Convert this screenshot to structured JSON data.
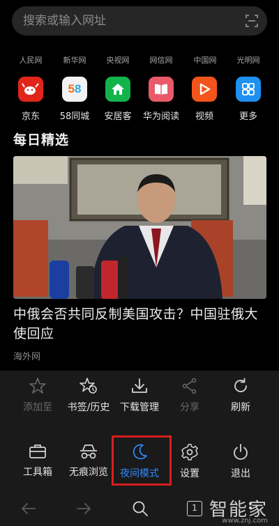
{
  "search": {
    "placeholder": "搜索或输入网址",
    "scan_icon": "scan-icon"
  },
  "sites": [
    "人民网",
    "新华网",
    "央视网",
    "网信网",
    "中国网",
    "光明网"
  ],
  "apps": [
    {
      "label": "京东",
      "icon": "jd-icon",
      "color": "#e1251b"
    },
    {
      "label": "58同城",
      "icon": "58-icon",
      "color": "#f2f2f2"
    },
    {
      "label": "安居客",
      "icon": "anjuke-icon",
      "color": "#13b34b"
    },
    {
      "label": "华为阅读",
      "icon": "huawei-reading-icon",
      "color": "#e85a6a"
    },
    {
      "label": "视频",
      "icon": "video-icon",
      "color": "#f2541b"
    },
    {
      "label": "更多",
      "icon": "more-icon",
      "color": "#1f8ff0"
    }
  ],
  "section_title": "每日精选",
  "news": {
    "title": "中俄会否共同反制美国攻击？中国驻俄大使回应",
    "source": "海外网"
  },
  "menu": {
    "row1": [
      {
        "label": "添加至",
        "state": "disabled"
      },
      {
        "label": "书签/历史",
        "state": "normal"
      },
      {
        "label": "下载管理",
        "state": "normal"
      },
      {
        "label": "分享",
        "state": "disabled"
      },
      {
        "label": "刷新",
        "state": "normal"
      }
    ],
    "row2": [
      {
        "label": "工具箱",
        "state": "normal"
      },
      {
        "label": "无痕浏览",
        "state": "normal"
      },
      {
        "label": "夜间模式",
        "state": "active"
      },
      {
        "label": "设置",
        "state": "normal"
      },
      {
        "label": "退出",
        "state": "normal"
      }
    ]
  },
  "nav": {
    "tab_count": "1"
  },
  "watermark": {
    "text": "智能家",
    "url": "www.znj.com"
  },
  "colors": {
    "accent": "#2f8bff",
    "highlight": "#d81e1e",
    "panel": "#1a1a1a"
  }
}
